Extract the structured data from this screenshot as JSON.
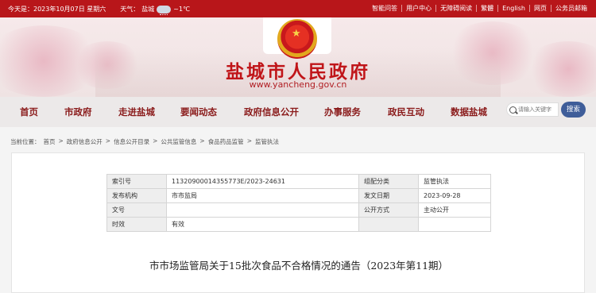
{
  "topbar": {
    "today": "今天是：2023年10月07日 星期六",
    "weather_label": "天气：",
    "weather_city": "盐城",
    "weather_temp": "~1℃",
    "links": [
      "智能问答",
      "用户中心",
      "无障碍阅读",
      "繁體",
      "English",
      "网页",
      "公务员邮箱"
    ]
  },
  "header": {
    "site_title": "盐城市人民政府",
    "domain": "www.yancheng.gov.cn",
    "emblem": "national-emblem"
  },
  "nav": {
    "items": [
      "首页",
      "市政府",
      "走进盐城",
      "要闻动态",
      "政府信息公开",
      "办事服务",
      "政民互动",
      "数据盐城"
    ],
    "search_placeholder": "请输入关键字",
    "search_button": "搜索"
  },
  "breadcrumb": {
    "label": "当前位置：",
    "items": [
      "首页",
      "政府信息公开",
      "信息公开目录",
      "公共监管信息",
      "食品药品监管",
      "监管执法"
    ],
    "separator": ">"
  },
  "meta_table": [
    {
      "k1": "索引号",
      "v1": "11320900014355773E/2023-24631",
      "k2": "组配分类",
      "v2": "监管执法"
    },
    {
      "k1": "发布机构",
      "v1": "市市监局",
      "k2": "发文日期",
      "v2": "2023-09-28"
    },
    {
      "k1": "文号",
      "v1": "",
      "k2": "公开方式",
      "v2": "主动公开"
    },
    {
      "k1": "时效",
      "v1": "有效",
      "k2": "",
      "v2": ""
    }
  ],
  "document": {
    "title": "市市场监管局关于15批次食品不合格情况的通告（2023年第11期）"
  },
  "colors": {
    "brand_red": "#b8161a",
    "nav_text": "#8a1a1a",
    "search_button": "#3f5d99"
  }
}
